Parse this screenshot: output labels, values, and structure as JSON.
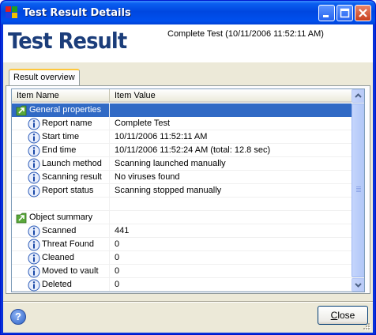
{
  "window": {
    "title": "Test Result Details"
  },
  "header": {
    "big_title": "Test Result",
    "subtitle": "Complete Test (10/11/2006 11:52:11 AM)"
  },
  "tabs": [
    {
      "label": "Result overview",
      "active": true
    }
  ],
  "table": {
    "columns": [
      "Item Name",
      "Item Value"
    ],
    "rows": [
      {
        "type": "group",
        "name": "General properties",
        "value": "",
        "icon": "folder-arrow-icon",
        "selected": true
      },
      {
        "type": "item",
        "name": "Report name",
        "value": "Complete Test",
        "icon": "info-icon"
      },
      {
        "type": "item",
        "name": "Start time",
        "value": "10/11/2006 11:52:11 AM",
        "icon": "info-icon"
      },
      {
        "type": "item",
        "name": "End time",
        "value": "10/11/2006 11:52:24 AM  (total: 12.8 sec)",
        "icon": "info-icon"
      },
      {
        "type": "item",
        "name": "Launch method",
        "value": "Scanning launched manually",
        "icon": "info-icon"
      },
      {
        "type": "item",
        "name": "Scanning result",
        "value": "No viruses found",
        "icon": "info-icon"
      },
      {
        "type": "item",
        "name": "Report status",
        "value": "Scanning stopped manually",
        "icon": "info-icon"
      },
      {
        "type": "blank",
        "name": "",
        "value": ""
      },
      {
        "type": "group",
        "name": "Object summary",
        "value": "",
        "icon": "folder-arrow-icon"
      },
      {
        "type": "item",
        "name": "Scanned",
        "value": "441",
        "icon": "info-icon"
      },
      {
        "type": "item",
        "name": "Threat Found",
        "value": "0",
        "icon": "info-icon"
      },
      {
        "type": "item",
        "name": "Cleaned",
        "value": "0",
        "icon": "info-icon"
      },
      {
        "type": "item",
        "name": "Moved to vault",
        "value": "0",
        "icon": "info-icon"
      },
      {
        "type": "item",
        "name": "Deleted",
        "value": "0",
        "icon": "info-icon"
      },
      {
        "type": "item",
        "name": "",
        "value": "",
        "icon": "info-icon"
      }
    ]
  },
  "footer": {
    "help_label": "?",
    "close_label": "Close",
    "close_mnemonic": "C",
    "close_rest": "lose"
  },
  "colors": {
    "selection": "#316ac5",
    "title_blue": "#1b3d7a",
    "titlebar": "#0047e0"
  }
}
